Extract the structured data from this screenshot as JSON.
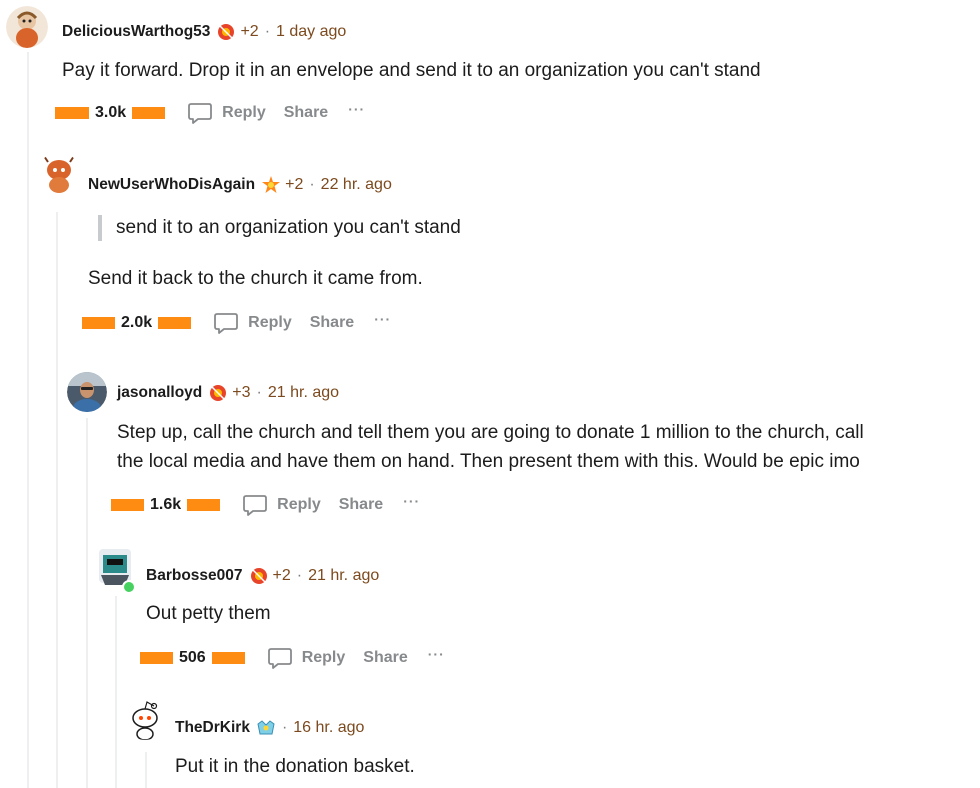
{
  "comments": [
    {
      "username": "DeliciousWarthog53",
      "award_count": "+2",
      "separator": "·",
      "time": "1 day ago",
      "body": "Pay it forward. Drop it in an envelope and send it to an organization you can't stand",
      "votes": "3.0k",
      "reply_label": "Reply",
      "share_label": "Share",
      "more_label": "···"
    },
    {
      "username": "NewUserWhoDisAgain",
      "award_count": "+2",
      "separator": "·",
      "time": "22 hr. ago",
      "quote": "send it to an organization you can't stand",
      "body": "Send it back to the church it came from.",
      "votes": "2.0k",
      "reply_label": "Reply",
      "share_label": "Share",
      "more_label": "···"
    },
    {
      "username": "jasonalloyd",
      "award_count": "+3",
      "separator": "·",
      "time": "21 hr. ago",
      "body_line1": "Step up, call the church and tell them you are going to donate 1 million to the church, call",
      "body_line2": "the local media and have them on hand. Then present them with this. Would be epic imo",
      "votes": "1.6k",
      "reply_label": "Reply",
      "share_label": "Share",
      "more_label": "···"
    },
    {
      "username": "Barbosse007",
      "award_count": "+2",
      "separator": "·",
      "time": "21 hr. ago",
      "body": "Out petty them",
      "votes": "506",
      "reply_label": "Reply",
      "share_label": "Share",
      "more_label": "···"
    },
    {
      "username": "TheDrKirk",
      "separator": "·",
      "time": "16 hr. ago",
      "body": "Put it in the donation basket."
    }
  ],
  "colors": {
    "vote_bar": "#ff8c12",
    "thread_line": "#edeff1",
    "action_text": "#878a8c",
    "time_text": "#7c4a1e"
  }
}
